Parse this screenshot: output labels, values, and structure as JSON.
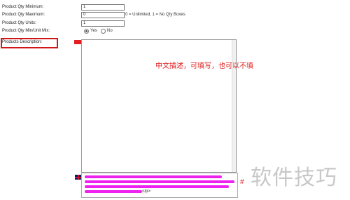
{
  "form": {
    "qty_min": {
      "label": "Product Qty Minimum:",
      "value": "1"
    },
    "qty_max": {
      "label": "Product Qty Maximum:",
      "value": "0",
      "hint": "0 = Unlimited, 1 = No Qty Boxes"
    },
    "qty_units": {
      "label": "Product Qty Units:",
      "value": "1"
    },
    "qty_mix": {
      "label": "Product Qty Min/Unit Mix:",
      "options": [
        "Yes",
        "No"
      ],
      "selected": "Yes"
    },
    "description": {
      "label": "Products Description:"
    }
  },
  "editor": {
    "annotation": "中文描述，可填写，也可以不填",
    "source_fragment": "</p>"
  },
  "overlay": {
    "watermark": "软件技巧",
    "side_char": "#"
  },
  "colors": {
    "highlight": "#d01818",
    "scribble": "#ee22ee",
    "annotation": "#e02020"
  },
  "icons": {
    "flag_cn": "flag-cn-icon",
    "flag_uk": "flag-uk-icon"
  }
}
